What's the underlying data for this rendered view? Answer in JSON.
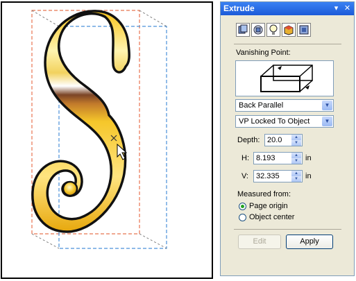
{
  "panel": {
    "title": "Extrude",
    "pin_symbol": "▾",
    "close_symbol": "✕",
    "tools": [
      {
        "icon": "preset-icon"
      },
      {
        "icon": "extrude-rotation-icon"
      },
      {
        "icon": "lighting-bulb-icon"
      },
      {
        "icon": "color-icon"
      },
      {
        "icon": "bevel-icon"
      }
    ],
    "vanishing_point_label": "Vanishing Point:",
    "extrude_type": "Back Parallel",
    "vp_lock": "VP Locked To Object",
    "depth_label": "Depth:",
    "depth_value": "20.0",
    "h_label": "H:",
    "h_value": "8.193",
    "h_unit": "in",
    "v_label": "V:",
    "v_value": "32.335",
    "v_unit": "in",
    "measured_from_label": "Measured from:",
    "options": [
      "Page origin",
      "Object center"
    ],
    "selected_option": "Page origin",
    "edit_label": "Edit",
    "apply_label": "Apply"
  },
  "colors": {
    "title_bar": "#2160e0",
    "panel_bg": "#ece9d8",
    "front_guide": "#4a90d9",
    "back_guide": "#e8734f",
    "gold_light": "#fff2a0",
    "gold_dark": "#c89a10",
    "brown_band": "#6b3a1e"
  }
}
